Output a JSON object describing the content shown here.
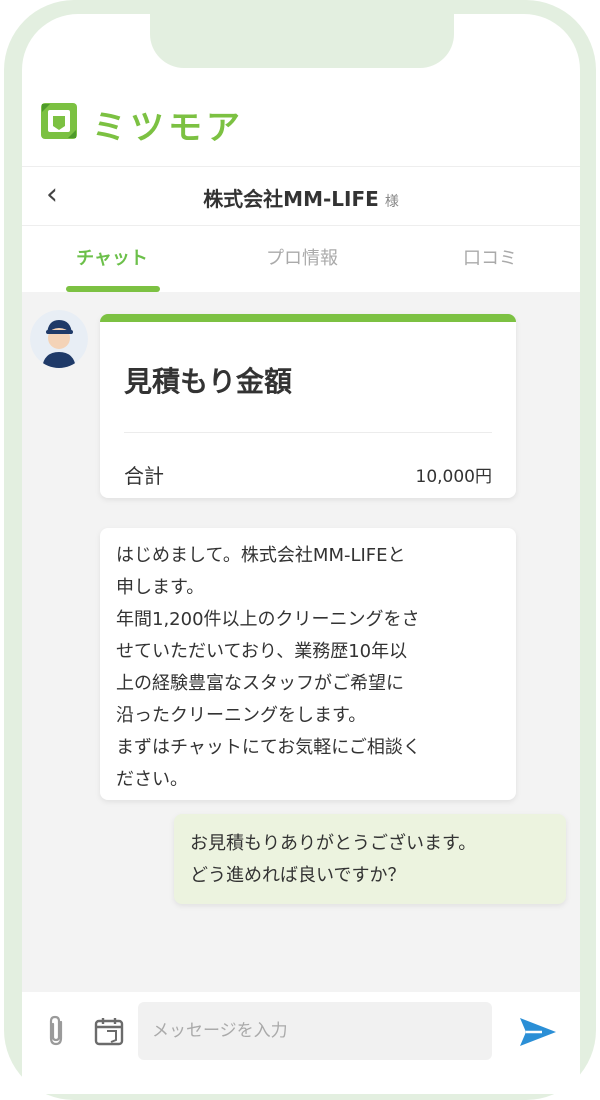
{
  "app": {
    "name": "ミツモア",
    "accent": "#7cc142"
  },
  "nav": {
    "company_name": "株式会社MM-LIFE",
    "company_suffix": "様"
  },
  "tabs": [
    {
      "label": "チャット",
      "active": true
    },
    {
      "label": "プロ情報",
      "active": false
    },
    {
      "label": "口コミ",
      "active": false
    }
  ],
  "estimate": {
    "title": "見積もり金額",
    "total_label": "合計",
    "total_value": "10,000円"
  },
  "messages": [
    {
      "from": "pro",
      "text": "はじめまして。株式会社MM-LIFEと\n申します。\n年間1,200件以上のクリーニングをさ\nせていただいており、業務歴10年以\n上の経験豊富なスタッフがご希望に\n沿ったクリーニングをします。\nまずはチャットにてお気軽にご相談く\nださい。"
    },
    {
      "from": "user",
      "text": "お見積もりありがとうございます。\nどう進めれば良いですか？"
    }
  ],
  "input": {
    "placeholder": "メッセージを入力"
  },
  "icons": {
    "back": "chevron-left-icon",
    "attach": "paperclip-icon",
    "calendar": "calendar-icon",
    "send": "send-icon"
  }
}
